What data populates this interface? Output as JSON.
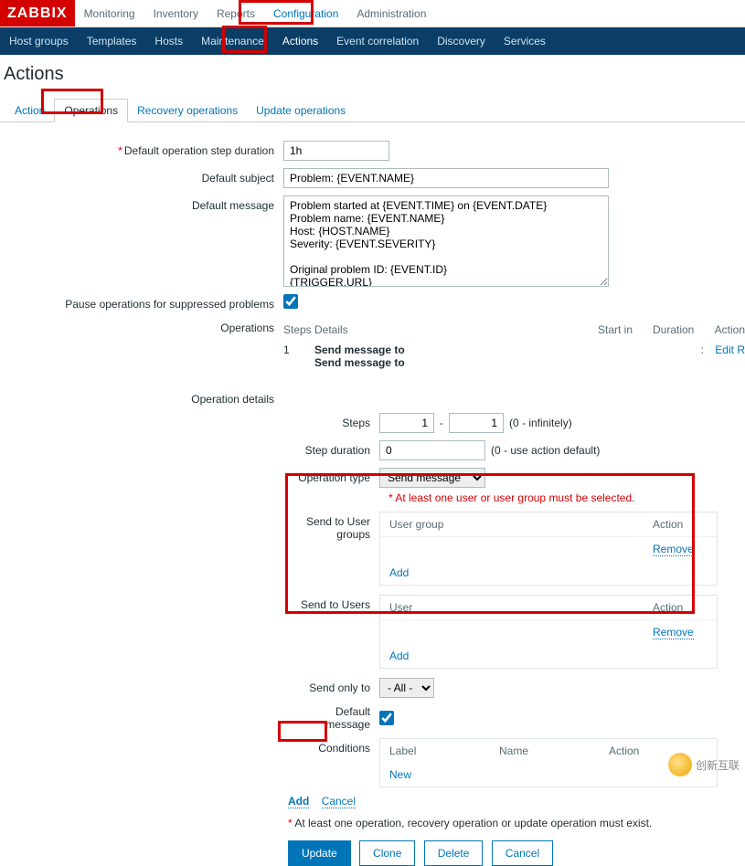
{
  "app": {
    "logo": "ZABBIX"
  },
  "topmenu": {
    "monitoring": "Monitoring",
    "inventory": "Inventory",
    "reports": "Reports",
    "configuration": "Configuration",
    "administration": "Administration"
  },
  "submenu": {
    "hostgroups": "Host groups",
    "templates": "Templates",
    "hosts": "Hosts",
    "maintenance": "Maintenance",
    "actions": "Actions",
    "eventcorr": "Event correlation",
    "discovery": "Discovery",
    "services": "Services"
  },
  "page_title": "Actions",
  "tabs": {
    "action": "Action",
    "operations": "Operations",
    "recovery": "Recovery operations",
    "update": "Update operations"
  },
  "labels": {
    "default_step_duration": "Default operation step duration",
    "default_subject": "Default subject",
    "default_message": "Default message",
    "pause": "Pause operations for suppressed problems",
    "operations": "Operations",
    "operation_details": "Operation details",
    "steps": "Steps",
    "step_duration": "Step duration",
    "operation_type": "Operation type",
    "send_to_user_groups": "Send to User groups",
    "send_to_users": "Send to Users",
    "send_only_to": "Send only to",
    "default_message_chk": "Default message",
    "conditions": "Conditions"
  },
  "values": {
    "step_duration": "1h",
    "subject": "Problem: {EVENT.NAME}",
    "message": "Problem started at {EVENT.TIME} on {EVENT.DATE}\nProblem name: {EVENT.NAME}\nHost: {HOST.NAME}\nSeverity: {EVENT.SEVERITY}\n\nOriginal problem ID: {EVENT.ID}\n{TRIGGER.URL}",
    "steps_from": "1",
    "steps_to": "1",
    "steps_hint": "(0 - infinitely)",
    "step_duration_val": "0",
    "step_duration_hint": "(0 - use action default)",
    "op_type": "Send message",
    "send_only_to": "- All -"
  },
  "ops_table": {
    "head": {
      "steps": "Steps",
      "details": "Details",
      "startin": "Start in",
      "duration": "Duration",
      "action": "Action"
    },
    "row": {
      "step": "1",
      "line1": "Send message to",
      "line2": "Send message to",
      "edit": "Edit",
      "remove": "R"
    }
  },
  "warning": "At least one user or user group must be selected.",
  "subtable": {
    "usergroup_head": "User group",
    "user_head": "User",
    "action_head": "Action",
    "remove": "Remove",
    "add": "Add"
  },
  "conditions": {
    "label_col": "Label",
    "name_col": "Name",
    "action_col": "Action",
    "new": "New"
  },
  "bottom_links": {
    "add": "Add",
    "cancel": "Cancel"
  },
  "footer_warn": "At least one operation, recovery operation or update operation must exist.",
  "buttons": {
    "update": "Update",
    "clone": "Clone",
    "delete": "Delete",
    "cancel": "Cancel"
  },
  "watermark": "创新互联"
}
